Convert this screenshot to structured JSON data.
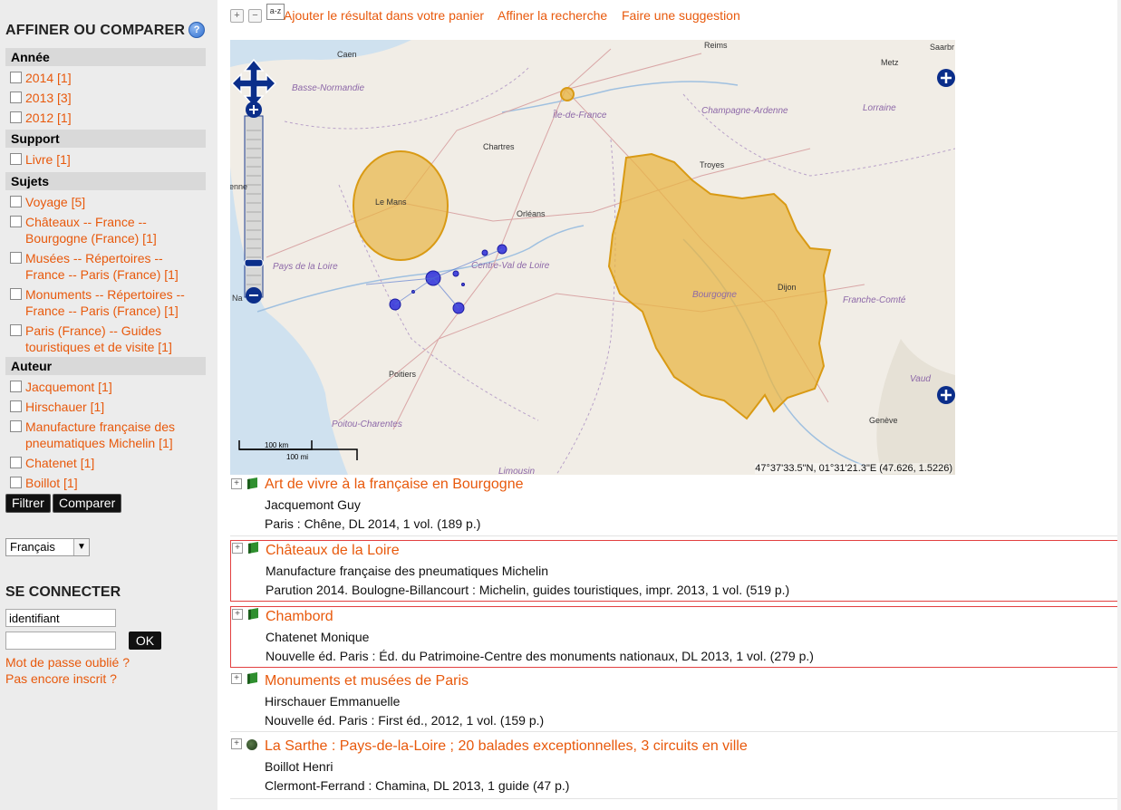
{
  "sidebar": {
    "title": "AFFINER OU COMPARER",
    "help_icon": "?",
    "facets": {
      "annee": {
        "header": "Année",
        "items": [
          "2014 [1]",
          "2013 [3]",
          "2012 [1]"
        ]
      },
      "support": {
        "header": "Support",
        "items": [
          "Livre [1]"
        ]
      },
      "sujets": {
        "header": "Sujets",
        "items": [
          "Voyage [5]",
          "Châteaux -- France --",
          "Bourgogne (France) [1]",
          "Musées -- Répertoires --",
          "France -- Paris (France) [1]",
          "Monuments -- Répertoires --",
          "France -- Paris (France) [1]",
          "Paris (France) -- Guides",
          "touristiques et de visite [1]"
        ]
      },
      "auteur": {
        "header": "Auteur",
        "items": [
          "Jacquemont [1]",
          "Hirschauer [1]",
          "Manufacture française des",
          "pneumatiques Michelin [1]",
          "Chatenet [1]",
          "Boillot [1]"
        ]
      }
    },
    "filter_button": "Filtrer",
    "compare_button": "Comparer",
    "language_select": "Français",
    "login": {
      "title": "SE CONNECTER",
      "username_value": "identifiant",
      "password_value": "",
      "ok_button": "OK",
      "forgot_password": "Mot de passe oublié ?",
      "not_registered": "Pas encore inscrit ?"
    }
  },
  "toolbar": {
    "expand_icon": "+",
    "collapse_icon": "−",
    "sort_icon": "a-z",
    "add_to_cart": "Ajouter le résultat dans votre panier",
    "refine_search": "Affiner la recherche",
    "make_suggestion": "Faire une suggestion"
  },
  "map": {
    "labels": {
      "reims": "Reims",
      "caen": "Caen",
      "metz": "Metz",
      "saarbr": "Saarbr",
      "basse_normandie": "Basse-Normandie",
      "ile_de_france": "Île-de-France",
      "champagne_ardenne": "Champagne-Ardenne",
      "lorraine": "Lorraine",
      "chartres": "Chartres",
      "troyes": "Troyes",
      "le_mans": "Le Mans",
      "orleans": "Orléans",
      "pays_de_la_loire": "Pays de la Loire",
      "centre": "Centre-Val de Loire",
      "bourgogne": "Bourgogne",
      "dijon": "Dijon",
      "franche_comte": "Franche-Comté",
      "rennes": "enne",
      "nantes": "Na",
      "poitiers": "Poitiers",
      "vaud": "Vaud",
      "geneve": "Genève",
      "poitou_charentes": "Poitou-Charentes",
      "limousin": "Limousin"
    },
    "scale_km": "100 km",
    "scale_mi": "100 mi",
    "coordinates": "47°37'33.5\"N, 01°31'21.3\"E (47.626, 1.5226)",
    "zoom_level_fraction": 0.14,
    "colors": {
      "region_fill": "#e8b545",
      "region_stroke": "#d99a14",
      "marker_fill": "#2b2bd9",
      "control_blue": "#0b2e8a"
    }
  },
  "results": [
    {
      "title": "Art de vivre à la française en Bourgogne",
      "author": "Jacquemont Guy",
      "pub": "Paris : Chêne, DL 2014, 1 vol. (189 p.)",
      "icon": "book-icon"
    },
    {
      "title": "Châteaux de la Loire",
      "author": "Manufacture française des pneumatiques Michelin",
      "pub": "Parution 2014. Boulogne-Billancourt : Michelin, guides touristiques, impr. 2013, 1 vol. (519 p.)",
      "icon": "book-icon"
    },
    {
      "title": "Chambord",
      "author": "Chatenet Monique",
      "pub": "Nouvelle éd. Paris : Éd. du Patrimoine-Centre des monuments nationaux, DL 2013, 1 vol. (279 p.)",
      "icon": "book-icon"
    },
    {
      "title": "Monuments et musées de Paris",
      "author": "Hirschauer Emmanuelle",
      "pub": "Nouvelle éd. Paris : First éd., 2012, 1 vol. (159 p.)",
      "icon": "book-icon"
    },
    {
      "title": "La Sarthe : Pays-de-la-Loire ; 20 balades exceptionnelles, 3 circuits en ville",
      "author": "Boillot Henri",
      "pub": "Clermont-Ferrand : Chamina, DL 2013, 1 guide (47 p.)",
      "icon": "globe-icon"
    }
  ]
}
